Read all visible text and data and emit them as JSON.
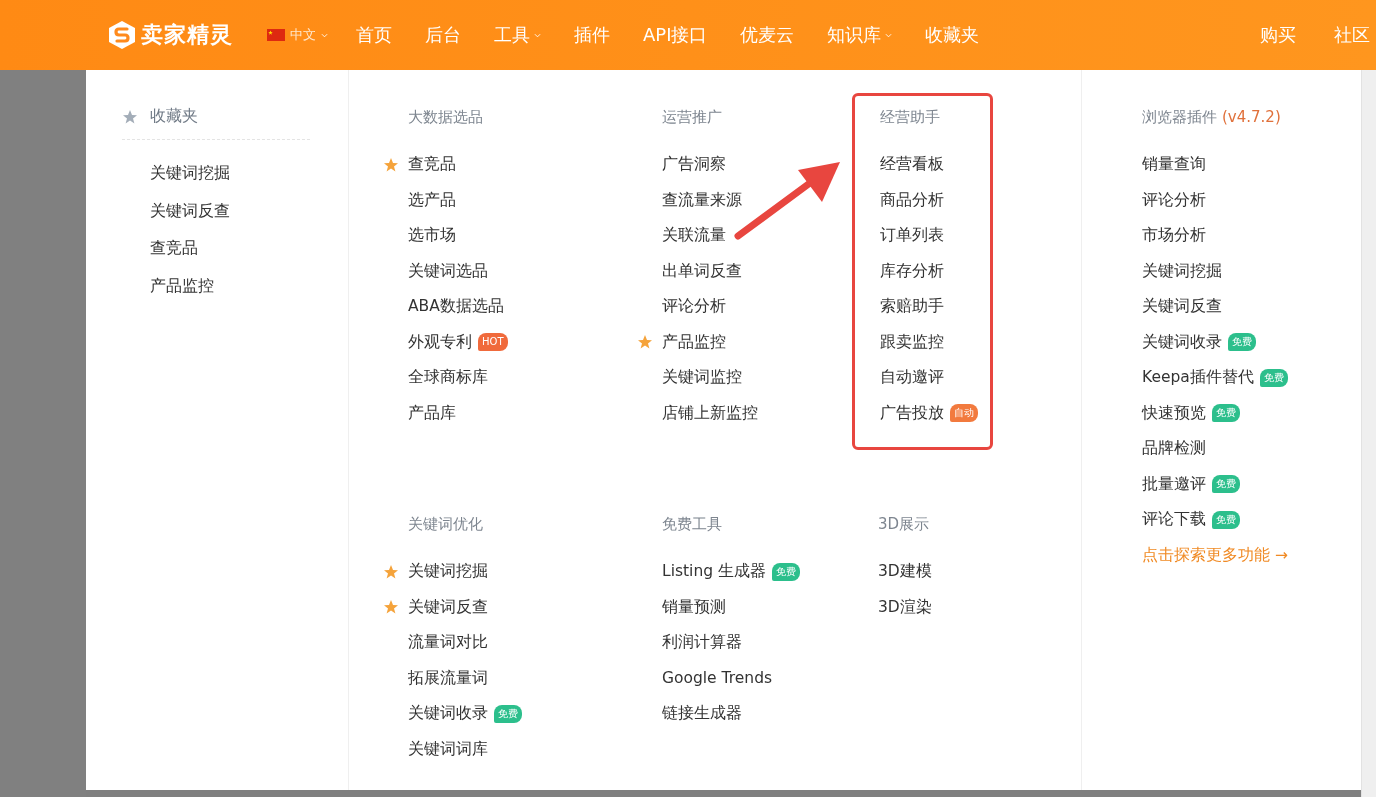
{
  "header": {
    "logo": "卖家精灵",
    "language": {
      "label": "中文",
      "dropdown": true
    },
    "nav": [
      {
        "label": "首页",
        "dropdown": false
      },
      {
        "label": "后台",
        "dropdown": false
      },
      {
        "label": "工具",
        "dropdown": true
      },
      {
        "label": "插件",
        "dropdown": false
      },
      {
        "label": "API接口",
        "dropdown": false
      },
      {
        "label": "优麦云",
        "dropdown": false
      },
      {
        "label": "知识库",
        "dropdown": true
      },
      {
        "label": "收藏夹",
        "dropdown": false
      }
    ],
    "right_links": [
      "购买",
      "社区"
    ]
  },
  "favorites": {
    "title": "收藏夹",
    "items": [
      "关键词挖掘",
      "关键词反查",
      "查竞品",
      "产品监控"
    ]
  },
  "sections": [
    {
      "title": "大数据选品",
      "highlighted": false,
      "items": [
        {
          "label": "查竞品",
          "starred": true
        },
        {
          "label": "选产品",
          "starred": false
        },
        {
          "label": "选市场",
          "starred": false
        },
        {
          "label": "关键词选品",
          "starred": false
        },
        {
          "label": "ABA数据选品",
          "starred": false
        },
        {
          "label": "外观专利",
          "starred": false,
          "badge": {
            "text": "HOT",
            "kind": "hot"
          }
        },
        {
          "label": "全球商标库",
          "starred": false
        },
        {
          "label": "产品库",
          "starred": false
        }
      ]
    },
    {
      "title": "运营推广",
      "highlighted": false,
      "items": [
        {
          "label": "广告洞察",
          "starred": false
        },
        {
          "label": "查流量来源",
          "starred": false
        },
        {
          "label": "关联流量",
          "starred": false
        },
        {
          "label": "出单词反查",
          "starred": false
        },
        {
          "label": "评论分析",
          "starred": false
        },
        {
          "label": "产品监控",
          "starred": true
        },
        {
          "label": "关键词监控",
          "starred": false
        },
        {
          "label": "店铺上新监控",
          "starred": false
        }
      ]
    },
    {
      "title": "经营助手",
      "highlighted": true,
      "items": [
        {
          "label": "经营看板",
          "starred": false
        },
        {
          "label": "商品分析",
          "starred": false
        },
        {
          "label": "订单列表",
          "starred": false
        },
        {
          "label": "库存分析",
          "starred": false
        },
        {
          "label": "索赔助手",
          "starred": false
        },
        {
          "label": "跟卖监控",
          "starred": false
        },
        {
          "label": "自动邀评",
          "starred": false
        },
        {
          "label": "广告投放",
          "starred": false,
          "badge": {
            "text": "自动",
            "kind": "auto"
          }
        }
      ]
    },
    {
      "title": "关键词优化",
      "highlighted": false,
      "items": [
        {
          "label": "关键词挖掘",
          "starred": true
        },
        {
          "label": "关键词反查",
          "starred": true
        },
        {
          "label": "流量词对比",
          "starred": false
        },
        {
          "label": "拓展流量词",
          "starred": false
        },
        {
          "label": "关键词收录",
          "starred": false,
          "badge": {
            "text": "免费",
            "kind": "free"
          }
        },
        {
          "label": "关键词词库",
          "starred": false
        }
      ]
    },
    {
      "title": "免费工具",
      "highlighted": false,
      "items": [
        {
          "label": "Listing 生成器",
          "starred": false,
          "badge": {
            "text": "免费",
            "kind": "free"
          }
        },
        {
          "label": "销量预测",
          "starred": false
        },
        {
          "label": "利润计算器",
          "starred": false
        },
        {
          "label": "Google Trends",
          "starred": false
        },
        {
          "label": "链接生成器",
          "starred": false
        }
      ]
    },
    {
      "title": "3D展示",
      "highlighted": false,
      "items": [
        {
          "label": "3D建模",
          "starred": false
        },
        {
          "label": "3D渲染",
          "starred": false
        }
      ]
    }
  ],
  "plugin": {
    "title": "浏览器插件",
    "version": "(v4.7.2)",
    "items": [
      {
        "label": "销量查询"
      },
      {
        "label": "评论分析"
      },
      {
        "label": "市场分析"
      },
      {
        "label": "关键词挖掘"
      },
      {
        "label": "关键词反查"
      },
      {
        "label": "关键词收录",
        "badge": {
          "text": "免费",
          "kind": "free"
        }
      },
      {
        "label": "Keepa插件替代",
        "badge": {
          "text": "免费",
          "kind": "free"
        }
      },
      {
        "label": "快速预览",
        "badge": {
          "text": "免费",
          "kind": "free"
        }
      },
      {
        "label": "品牌检测"
      },
      {
        "label": "批量邀评",
        "badge": {
          "text": "免费",
          "kind": "free"
        }
      },
      {
        "label": "评论下载",
        "badge": {
          "text": "免费",
          "kind": "free"
        }
      }
    ],
    "more_link": "点击探索更多功能 →"
  }
}
